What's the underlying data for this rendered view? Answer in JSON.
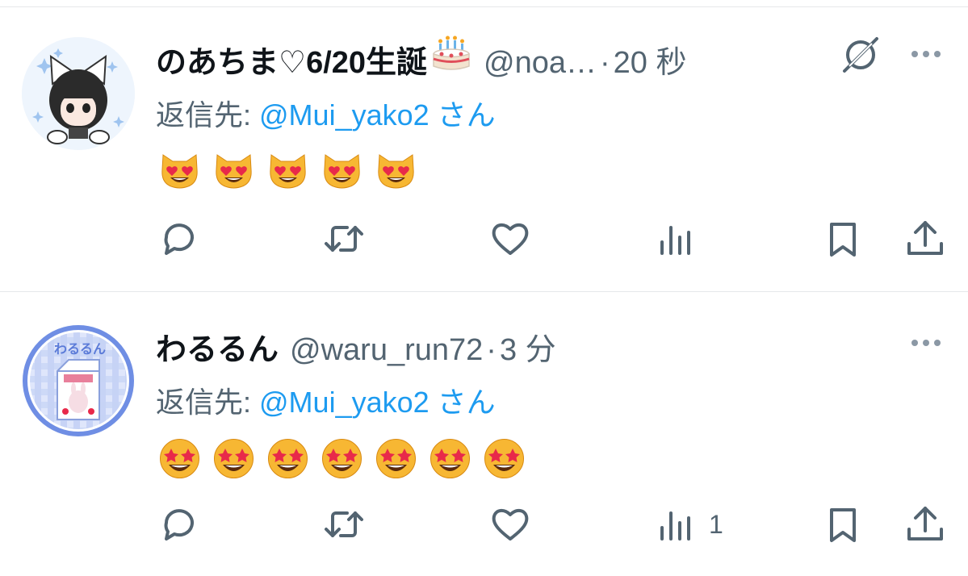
{
  "colors": {
    "text": "#0f1419",
    "muted": "#536471",
    "link": "#1d9bf0",
    "icon": "#536471",
    "divider": "#e6e8ea"
  },
  "tweets": [
    {
      "name": "のあちま♡6/20生誕",
      "name_icon": "birthday-cake-icon",
      "handle": "@noa…",
      "separator": "·",
      "time": "20 秒",
      "reply_prefix": "返信先: ",
      "reply_to": "@Mui_yako2",
      "reply_suffix": " さん",
      "emoji_name": "smiling-cat-heart-eyes-emoji",
      "emoji_count": 5,
      "views": "",
      "avatar_icon": "catgirl-avatar"
    },
    {
      "name": "わるるん",
      "handle": "@waru_run72",
      "separator": "·",
      "time": "3 分",
      "reply_prefix": "返信先: ",
      "reply_to": "@Mui_yako2",
      "reply_suffix": " さん",
      "emoji_name": "star-struck-emoji",
      "emoji_count": 7,
      "views": "1",
      "avatar_icon": "milk-carton-avatar",
      "avatar_text": "わるるん"
    }
  ],
  "actions": [
    "reply-icon",
    "repost-icon",
    "like-icon",
    "views-icon",
    "bookmark-icon",
    "share-icon"
  ]
}
